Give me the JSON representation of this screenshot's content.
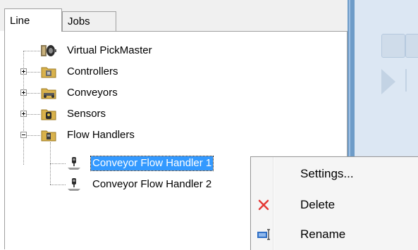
{
  "tabs": [
    {
      "label": "Line",
      "active": true
    },
    {
      "label": "Jobs",
      "active": false
    }
  ],
  "tree": {
    "nodes": [
      {
        "label": "Virtual PickMaster",
        "icon": "pickmaster-icon",
        "expander": "none"
      },
      {
        "label": "Controllers",
        "icon": "folder-icon",
        "expander": "plus"
      },
      {
        "label": "Conveyors",
        "icon": "conveyor-icon",
        "expander": "plus"
      },
      {
        "label": "Sensors",
        "icon": "sensor-icon",
        "expander": "plus"
      },
      {
        "label": "Flow Handlers",
        "icon": "folder-icon",
        "expander": "minus"
      },
      {
        "label": "Conveyor Flow Handler 1",
        "icon": "flow-handler-icon",
        "selected": true
      },
      {
        "label": "Conveyor Flow Handler 2",
        "icon": "flow-handler-icon",
        "selected": false
      }
    ]
  },
  "context_menu": {
    "items": [
      {
        "label": "Settings...",
        "icon": "none"
      },
      {
        "label": "Delete",
        "icon": "delete-x-icon"
      },
      {
        "label": "Rename",
        "icon": "rename-icon"
      }
    ]
  },
  "colors": {
    "selection": "#3399ff",
    "splitter": "#6e9cc8",
    "right_panel": "#dce7f3",
    "delete_x": "#e53935",
    "rename_icon": "#2f6fc5"
  }
}
